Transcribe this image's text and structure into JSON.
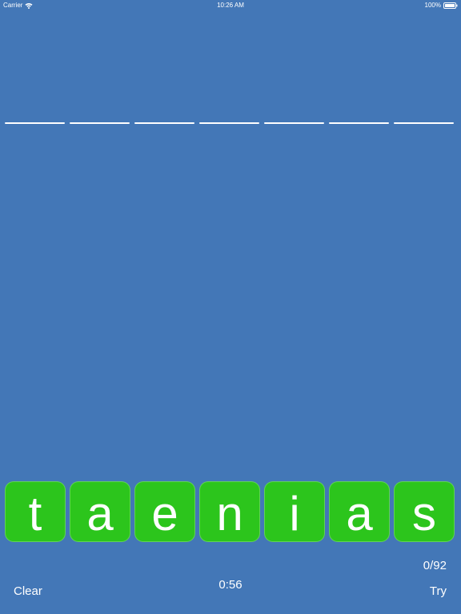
{
  "status_bar": {
    "carrier": "Carrier",
    "time": "10:26 AM",
    "battery": "100%"
  },
  "answer_slots": 7,
  "tiles": [
    "t",
    "a",
    "e",
    "n",
    "i",
    "a",
    "s"
  ],
  "score": "0/92",
  "timer": "0:56",
  "buttons": {
    "clear": "Clear",
    "try": "Try"
  },
  "colors": {
    "background": "#4377b7",
    "tile": "#2cc51c",
    "text": "#ffffff"
  },
  "icons": {
    "wifi": "wifi-icon",
    "battery": "battery-icon"
  }
}
